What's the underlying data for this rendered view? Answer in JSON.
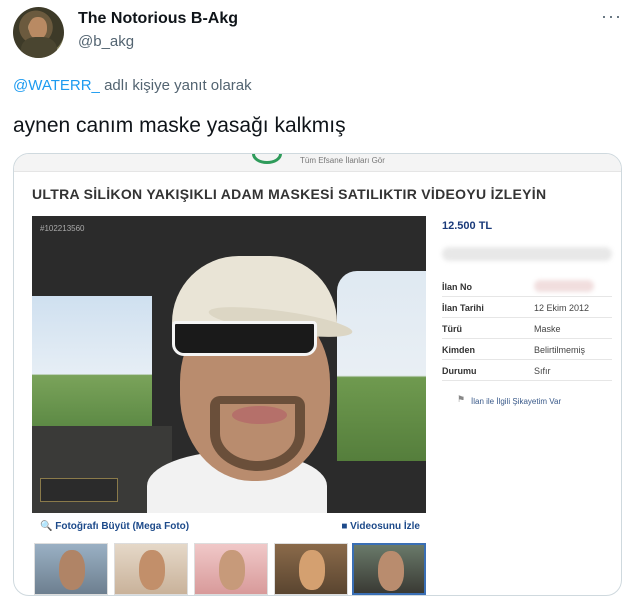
{
  "tweet": {
    "display_name": "The Notorious B-Akg",
    "handle": "@b_akg",
    "more_icon": "more-dots-icon",
    "reply_mention": "@WATERR_",
    "reply_text": "adlı kişiye yanıt olarak",
    "text": "aynen canım maske yasağı kalkmış"
  },
  "card": {
    "header_text": "Tüm Efsane İlanları Gör",
    "listing_title": "ULTRA SİLİKON YAKIŞIKLI ADAM MASKESİ SATILIKTIR VİDEOYU İZLEYİN",
    "photo_id": "#102213560",
    "price": "12.500 TL",
    "details": [
      {
        "key": "İlan No",
        "value": ""
      },
      {
        "key": "İlan Tarihi",
        "value": "12 Ekim 2012"
      },
      {
        "key": "Türü",
        "value": "Maske"
      },
      {
        "key": "Kimden",
        "value": "Belirtilmemiş"
      },
      {
        "key": "Durumu",
        "value": "Sıfır"
      }
    ],
    "complaint_link": "İlan ile İlgili Şikayetim Var",
    "enlarge_link": "Fotoğrafı Büyüt (Mega Foto)",
    "video_link": "Videosunu İzle",
    "thumbnails_count": 5
  }
}
